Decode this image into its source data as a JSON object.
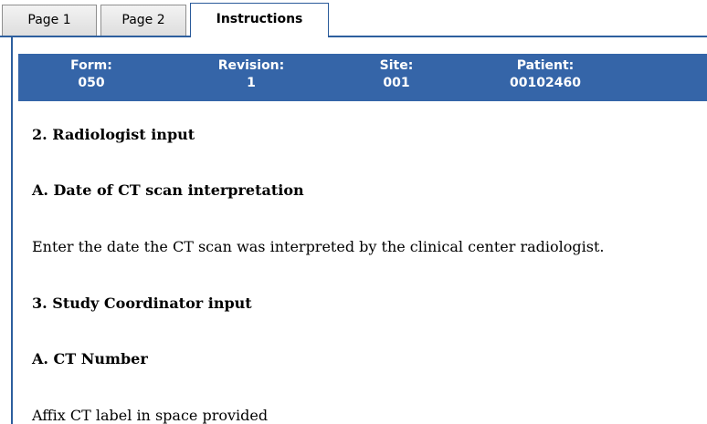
{
  "tabs": [
    {
      "label": "Page 1",
      "active": false
    },
    {
      "label": "Page 2",
      "active": false
    },
    {
      "label": "Instructions",
      "active": true
    }
  ],
  "header": {
    "form_label": "Form:",
    "form_value": "050",
    "revision_label": "Revision:",
    "revision_value": "1",
    "site_label": "Site:",
    "site_value": "001",
    "patient_label": "Patient:",
    "patient_value": "00102460"
  },
  "instructions": {
    "section2_title": "2. Radiologist input",
    "section2a_title": "A. Date of CT scan interpretation",
    "section2a_text": "Enter the date the CT scan was interpreted by the clinical center radiologist.",
    "section3_title": "3. Study Coordinator input",
    "section3a_title": "A. CT Number",
    "section3a_text": "Affix CT label in space provided"
  },
  "colors": {
    "accent": "#2d5f9e",
    "header_bar": "#3565a8",
    "header_text": "#ffffff"
  }
}
